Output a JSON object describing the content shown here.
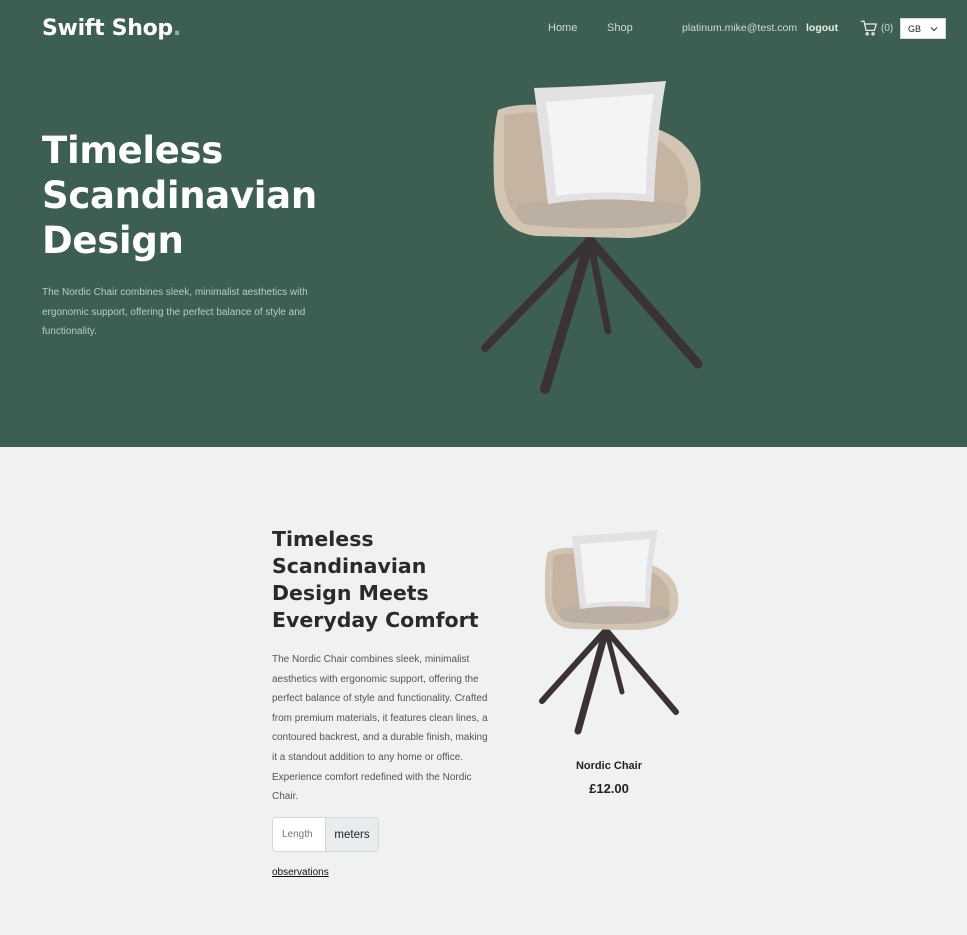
{
  "header": {
    "logo": "Swift Shop",
    "logo_dot": ".",
    "nav": {
      "home": "Home",
      "shop": "Shop"
    },
    "user_email": "platinum.mike@test.com",
    "logout": "logout",
    "cart_count": "(0)",
    "country": "GB"
  },
  "hero": {
    "title": "Timeless Scandinavian Design",
    "description": "The Nordic Chair combines sleek, minimalist aesthetics with ergonomic support, offering the perfect balance of style and functionality.",
    "image_icon": "chair-image"
  },
  "promo": {
    "title": "Timeless Scandinavian Design Meets Everyday Comfort",
    "description": "The Nordic Chair combines sleek, minimalist aesthetics with ergonomic support, offering the perfect balance of style and functionality. Crafted from premium materials, it features clean lines, a contoured backrest, and a durable finish, making it a standout addition to any home or office. Experience comfort redefined with the Nordic Chair.",
    "length_placeholder": "Length",
    "length_unit": "meters",
    "observations": "observations"
  },
  "product": {
    "name": "Nordic Chair",
    "price": "£12.00"
  },
  "colors": {
    "hero_bg": "#3d5f51",
    "page_bg": "#f0f1f1"
  }
}
